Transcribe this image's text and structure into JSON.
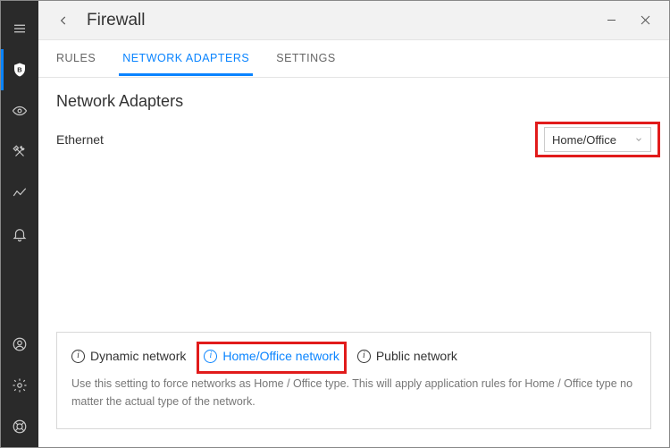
{
  "window": {
    "title": "Firewall"
  },
  "tabs": {
    "rules": "RULES",
    "adapters": "NETWORK ADAPTERS",
    "settings": "SETTINGS"
  },
  "section": {
    "title": "Network Adapters"
  },
  "adapter": {
    "name": "Ethernet",
    "selected": "Home/Office"
  },
  "options": {
    "dynamic": "Dynamic network",
    "home": "Home/Office network",
    "public": "Public network"
  },
  "description": "Use this setting to force networks as Home / Office type. This will apply application rules for Home / Office type no matter the actual type of the network."
}
